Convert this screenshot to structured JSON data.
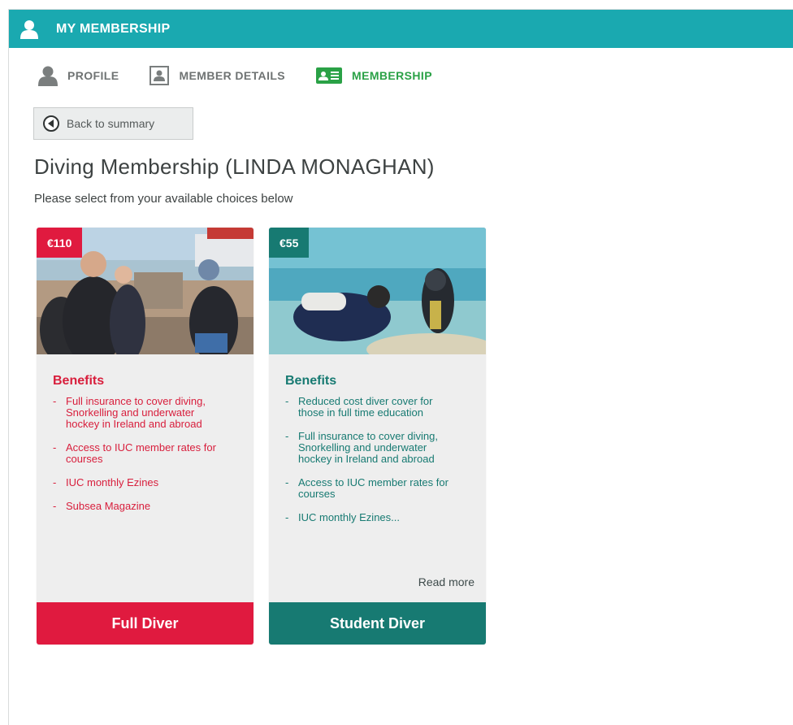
{
  "header": {
    "title": "MY MEMBERSHIP",
    "icon": "user-icon"
  },
  "tabs": [
    {
      "label": "PROFILE",
      "icon": "user-icon",
      "active": false
    },
    {
      "label": "MEMBER DETAILS",
      "icon": "id-card-icon",
      "active": false
    },
    {
      "label": "MEMBERSHIP",
      "icon": "membership-card-icon",
      "active": true
    }
  ],
  "back_button": {
    "label": "Back to summary",
    "icon": "back-arrow-icon"
  },
  "page": {
    "title": "Diving Membership (LINDA MONAGHAN)",
    "subtitle": "Please select from your available choices below"
  },
  "cards": [
    {
      "price": "€110",
      "benefits_title": "Benefits",
      "benefits": [
        "Full insurance to cover diving, Snorkelling and underwater hockey in Ireland and abroad",
        "Access to IUC member rates for courses",
        "IUC monthly Ezines",
        "Subsea Magazine"
      ],
      "button_label": "Full Diver",
      "accent": "#e01a3f"
    },
    {
      "price": "€55",
      "benefits_title": "Benefits",
      "benefits": [
        "Reduced cost diver cover for those in full time education",
        "Full insurance to cover diving, Snorkelling and underwater hockey in Ireland and abroad",
        "Access to IUC member rates for courses",
        "IUC monthly Ezines..."
      ],
      "read_more": "Read more",
      "button_label": "Student Diver",
      "accent": "#177a72"
    }
  ],
  "colors": {
    "header": "#1aa9b0",
    "active_tab": "#2aa146"
  }
}
